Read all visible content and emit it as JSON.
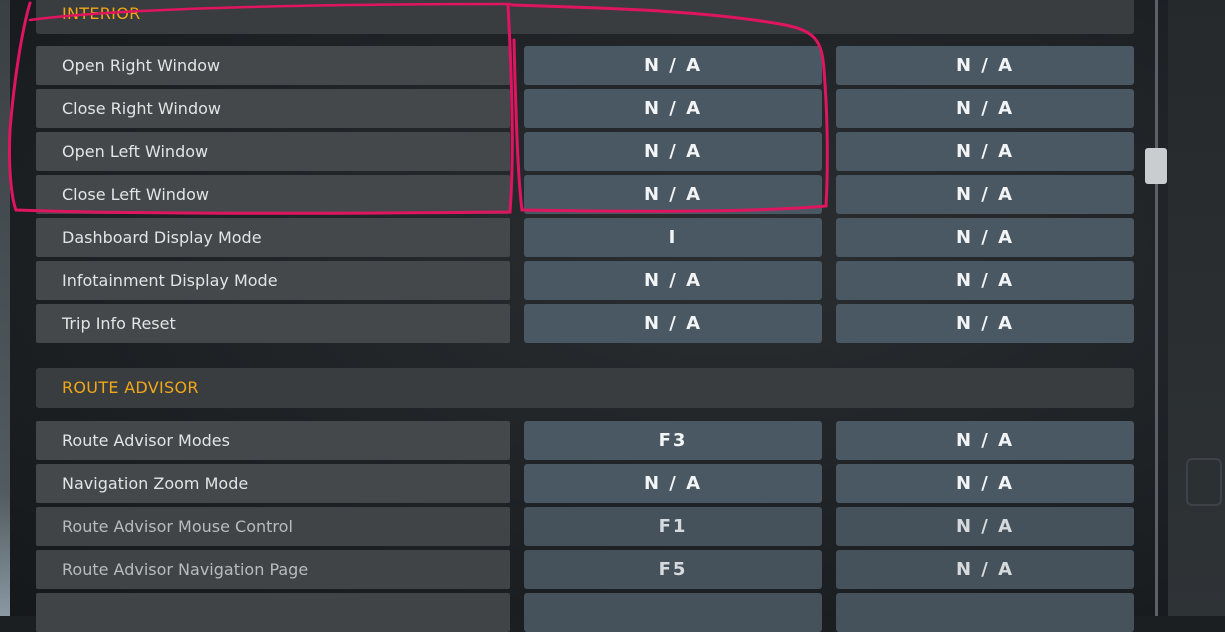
{
  "sections": [
    {
      "title": "INTERIOR",
      "rows": [
        {
          "label": "Open Right Window",
          "primary": "N / A",
          "secondary": "N / A"
        },
        {
          "label": "Close Right Window",
          "primary": "N / A",
          "secondary": "N / A"
        },
        {
          "label": "Open Left Window",
          "primary": "N / A",
          "secondary": "N / A"
        },
        {
          "label": "Close Left Window",
          "primary": "N / A",
          "secondary": "N / A"
        },
        {
          "label": "Dashboard Display Mode",
          "primary": "I",
          "secondary": "N / A"
        },
        {
          "label": "Infotainment Display Mode",
          "primary": "N / A",
          "secondary": "N / A"
        },
        {
          "label": "Trip Info Reset",
          "primary": "N / A",
          "secondary": "N / A"
        }
      ]
    },
    {
      "title": "ROUTE ADVISOR",
      "rows": [
        {
          "label": "Route Advisor Modes",
          "primary": "F3",
          "secondary": "N / A"
        },
        {
          "label": "Navigation Zoom Mode",
          "primary": "N / A",
          "secondary": "N / A"
        },
        {
          "label": "Route Advisor Mouse Control",
          "primary": "F1",
          "secondary": "N / A"
        },
        {
          "label": "Route Advisor Navigation Page",
          "primary": "F5",
          "secondary": "N / A"
        }
      ]
    }
  ],
  "colors": {
    "section_title": "#f0a718",
    "annotation": "#e0155f"
  }
}
